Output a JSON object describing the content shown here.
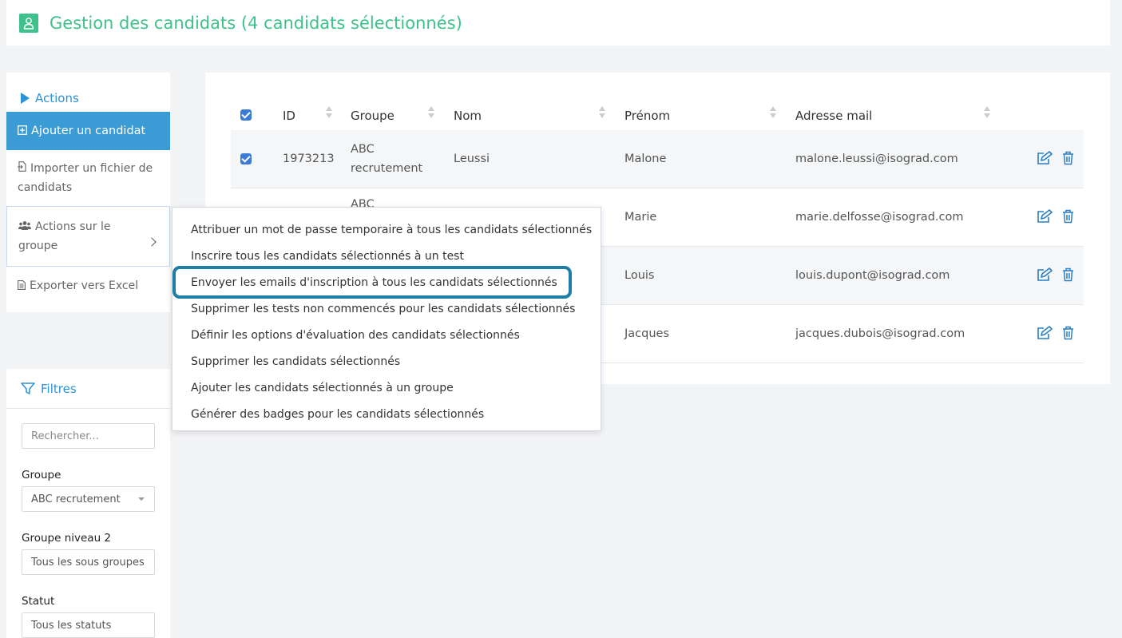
{
  "header": {
    "title": "Gestion des candidats (4 candidats sélectionnés)"
  },
  "actions": {
    "title": "Actions",
    "add": "Ajouter un candidat",
    "import": "Importer un fichier de candidats",
    "group_actions": "Actions sur le groupe",
    "export": "Exporter vers Excel"
  },
  "filters": {
    "title": "Filtres",
    "search_placeholder": "Rechercher...",
    "group_label": "Groupe",
    "group_value": "ABC recrutement",
    "group2_label": "Groupe niveau 2",
    "group2_value": "Tous les sous groupes",
    "status_label": "Statut",
    "status_value": "Tous les statuts"
  },
  "table": {
    "columns": {
      "id": "ID",
      "group": "Groupe",
      "nom": "Nom",
      "prenom": "Prénom",
      "email": "Adresse mail"
    },
    "rows": [
      {
        "id": "1973213",
        "group": "ABC recrutement",
        "nom": "Leussi",
        "prenom": "Malone",
        "email": "malone.leussi@isograd.com"
      },
      {
        "id": "",
        "group": "ABC",
        "nom": "",
        "prenom": "Marie",
        "email": "marie.delfosse@isograd.com"
      },
      {
        "id": "",
        "group": "",
        "nom": "",
        "prenom": "Louis",
        "email": "louis.dupont@isograd.com"
      },
      {
        "id": "",
        "group": "",
        "nom": "",
        "prenom": "Jacques",
        "email": "jacques.dubois@isograd.com"
      }
    ]
  },
  "menu": {
    "items": [
      "Attribuer un mot de passe temporaire à tous les candidats sélectionnés",
      "Inscrire tous les candidats sélectionnés à un test",
      "Envoyer les emails d'inscription à tous les candidats sélectionnés",
      "Supprimer les tests non commencés pour les candidats sélectionnés",
      "Définir les options d'évaluation des candidats sélectionnés",
      "Supprimer les candidats sélectionnés",
      "Ajouter les candidats sélectionnés à un groupe",
      "Générer des badges pour les candidats sélectionnés"
    ]
  },
  "colors": {
    "brand_green": "#3ec18b",
    "accent_blue": "#2b92d6",
    "primary_button": "#3a9bd5",
    "highlight_border": "#1f7ea5"
  }
}
